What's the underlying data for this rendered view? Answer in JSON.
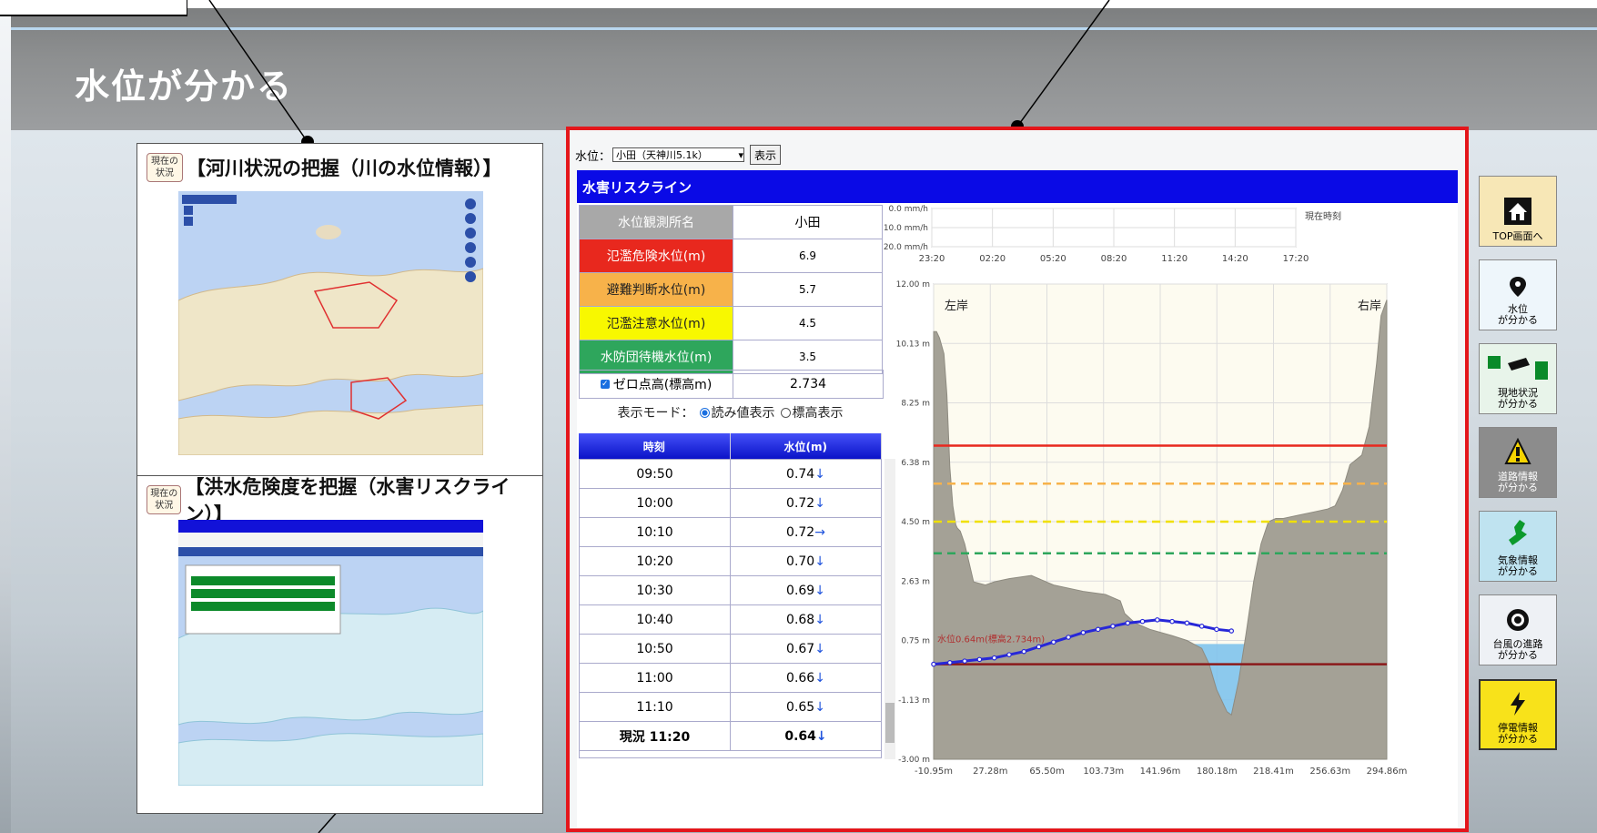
{
  "page": {
    "section_title": "水位が分かる"
  },
  "cards": [
    {
      "badge": [
        "現在の",
        "状況"
      ],
      "title": "【河川状況の把握（川の水位情報）】"
    },
    {
      "badge": [
        "現在の",
        "状況"
      ],
      "title": "【洪水危険度を把握（水害リスクライン）】"
    }
  ],
  "selector": {
    "label": "水位：",
    "value": "小田（天神川5.1k）",
    "button": "表示"
  },
  "risk": {
    "title": "水害リスクライン"
  },
  "thresholds": {
    "station_header": "水位観測所名",
    "station_name": "小田",
    "rows": [
      {
        "label": "氾濫危険水位(m)",
        "value": "6.9",
        "color": "#e8281e"
      },
      {
        "label": "避難判断水位(m)",
        "value": "5.7",
        "color": "#f7b24a"
      },
      {
        "label": "氾濫注意水位(m)",
        "value": "4.5",
        "color": "#f8f800"
      },
      {
        "label": "水防団待機水位(m)",
        "value": "3.5",
        "color": "#2ea65c"
      }
    ]
  },
  "zero": {
    "label": "ゼロ点高(標高m)",
    "value": "2.734"
  },
  "mode": {
    "label": "表示モード：",
    "option1": "読み値表示",
    "option2": "標高表示"
  },
  "waterlevel_table": {
    "headers": [
      "時刻",
      "水位(m)"
    ],
    "rows": [
      {
        "time": "09:50",
        "value": "0.74",
        "trend": "↓"
      },
      {
        "time": "10:00",
        "value": "0.72",
        "trend": "↓"
      },
      {
        "time": "10:10",
        "value": "0.72",
        "trend": "→"
      },
      {
        "time": "10:20",
        "value": "0.70",
        "trend": "↓"
      },
      {
        "time": "10:30",
        "value": "0.69",
        "trend": "↓"
      },
      {
        "time": "10:40",
        "value": "0.68",
        "trend": "↓"
      },
      {
        "time": "10:50",
        "value": "0.67",
        "trend": "↓"
      },
      {
        "time": "11:00",
        "value": "0.66",
        "trend": "↓"
      },
      {
        "time": "11:10",
        "value": "0.65",
        "trend": "↓"
      },
      {
        "time": "現況 11:20",
        "value": "0.64",
        "trend": "↓"
      }
    ]
  },
  "chart_data": [
    {
      "type": "area",
      "yticks": [
        "0.0 mm/h",
        "10.0 mm/h",
        "20.0 mm/h"
      ],
      "xticks": [
        "23:20",
        "02:20",
        "05:20",
        "08:20",
        "11:20",
        "14:20",
        "17:20"
      ],
      "ylim": [
        0,
        20
      ],
      "annotation": "現在時刻"
    },
    {
      "type": "area",
      "xticks": [
        "-10.95m",
        "27.28m",
        "65.50m",
        "103.73m",
        "141.96m",
        "180.18m",
        "218.41m",
        "256.63m",
        "294.86m"
      ],
      "yticks": [
        "12.00 m",
        "10.13 m",
        "8.25 m",
        "6.38 m",
        "4.50 m",
        "2.63 m",
        "0.75 m",
        "-1.13 m",
        "-3.00 m"
      ],
      "xlim": [
        -10.95,
        294.86
      ],
      "ylim": [
        -3.0,
        12.0
      ],
      "left_label": "左岸",
      "right_label": "右岸",
      "water_label": "水位0.64m(標高2.734m)",
      "threshold_lines": [
        {
          "name": "氾濫危険水位",
          "value": 6.9,
          "color": "#e8281e",
          "style": "solid"
        },
        {
          "name": "避難判断水位",
          "value": 5.7,
          "color": "#f7b24a",
          "style": "dashed"
        },
        {
          "name": "氾濫注意水位",
          "value": 4.5,
          "color": "#f0e000",
          "style": "dashed"
        },
        {
          "name": "水防団待機水位",
          "value": 3.5,
          "color": "#2ea65c",
          "style": "dashed"
        },
        {
          "name": "ゼロ点",
          "value": 0.0,
          "color": "#8b1a1a",
          "style": "solid"
        }
      ],
      "cross_section": {
        "x": [
          -10.95,
          -10.95,
          -9,
          -7,
          -4,
          -2,
          0,
          2,
          4,
          5,
          7,
          10,
          16,
          24,
          30,
          40,
          55,
          70,
          90,
          105,
          115,
          118,
          125,
          135,
          150,
          160,
          170,
          175,
          180,
          187,
          190,
          195,
          200,
          205,
          210,
          215,
          220,
          225,
          235,
          245,
          255,
          260,
          265,
          270,
          278,
          283,
          288,
          291,
          294.86,
          294.86
        ],
        "y": [
          -3.0,
          10.5,
          10.5,
          10.3,
          9.8,
          8.5,
          6.2,
          5.0,
          4.4,
          4.3,
          4.2,
          3.8,
          2.6,
          2.5,
          2.6,
          2.7,
          2.8,
          2.5,
          2.3,
          2.2,
          2.0,
          1.6,
          1.3,
          1.1,
          0.9,
          0.75,
          0.5,
          0.0,
          -0.8,
          -1.5,
          -1.6,
          -0.5,
          1.0,
          2.6,
          3.8,
          4.5,
          4.6,
          4.6,
          4.7,
          4.8,
          4.9,
          5.0,
          5.5,
          6.3,
          6.6,
          7.5,
          9.5,
          11.0,
          11.5,
          -3.0
        ]
      },
      "water_level": 0.64,
      "water_polyline": {
        "x": [
          -10.95,
          0,
          10,
          20,
          30,
          40,
          50,
          60,
          70,
          80,
          90,
          100,
          110,
          120,
          130,
          140,
          150,
          160,
          170,
          180,
          190
        ],
        "y": [
          0.0,
          0.05,
          0.1,
          0.15,
          0.2,
          0.3,
          0.4,
          0.55,
          0.7,
          0.85,
          1.0,
          1.1,
          1.2,
          1.3,
          1.35,
          1.4,
          1.35,
          1.3,
          1.2,
          1.1,
          1.05
        ]
      }
    }
  ],
  "right_nav": [
    {
      "label": "TOP画面へ",
      "icon": "home-icon",
      "bg": "#f7e7b6"
    },
    {
      "label": "水位\nが分かる",
      "icon": "pin-icon",
      "bg": "#eef6fb"
    },
    {
      "label": "現地状況\nが分かる",
      "icon": "camera-icon",
      "bg": "#e8f4ea"
    },
    {
      "label": "道路情報\nが分かる",
      "icon": "road-warning-icon",
      "bg": "#8c8c8c"
    },
    {
      "label": "気象情報\nが分かる",
      "icon": "weather-map-icon",
      "bg": "#bfe3f0"
    },
    {
      "label": "台風の進路\nが分かる",
      "icon": "typhoon-icon",
      "bg": "#eef1f5"
    },
    {
      "label": "停電情報\nが分かる",
      "icon": "lightning-icon",
      "bg": "#f8e21a"
    }
  ]
}
